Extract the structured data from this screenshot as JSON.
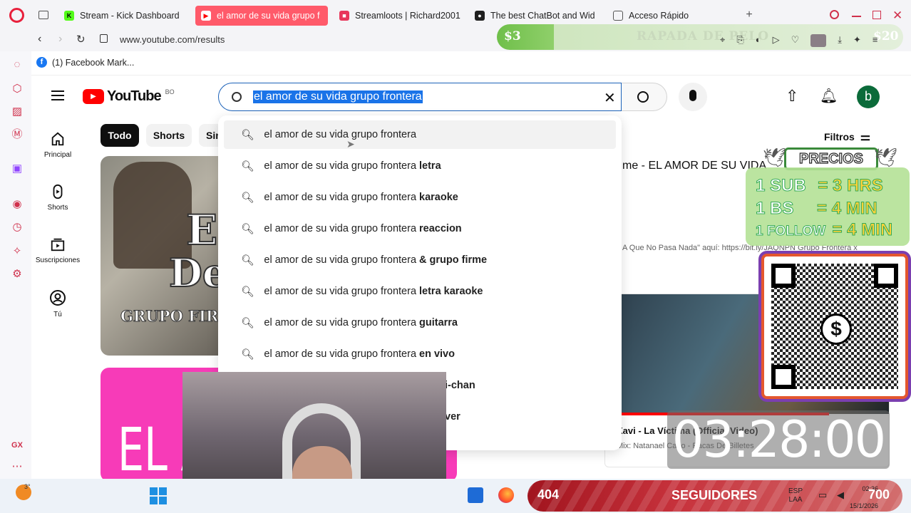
{
  "browser": {
    "tabs": [
      {
        "label": "Stream - Kick Dashboard",
        "color": "#53fc18"
      },
      {
        "label": "el amor de su vida grupo f",
        "color": "#ff0000"
      },
      {
        "label": "Streamloots | Richard2001",
        "color": "#e8365a"
      },
      {
        "label": "The best ChatBot and Wid",
        "color": "#1f1f1f"
      },
      {
        "label": "Acceso Rápido",
        "color": "#555555"
      }
    ],
    "url": "www.youtube.com/results",
    "bookmark": "(1) Facebook Mark..."
  },
  "youtube": {
    "logo": "YouTube",
    "region": "BO",
    "search_value": "el amor de su vida grupo frontera",
    "avatar_letter": "b",
    "filters_label": "Filtros",
    "chips": [
      "Todo",
      "Shorts",
      "Sin"
    ],
    "nav": [
      {
        "label": "Principal",
        "icon": "home-icon"
      },
      {
        "label": "Shorts",
        "icon": "shorts-icon"
      },
      {
        "label": "Suscripciones",
        "icon": "subscriptions-icon"
      },
      {
        "label": "Tú",
        "icon": "you-icon"
      }
    ],
    "suggestion_base": "el amor de su vida grupo frontera",
    "suggestions": [
      {
        "suffix": ""
      },
      {
        "suffix": "letra"
      },
      {
        "suffix": "karaoke"
      },
      {
        "suffix": "reaccion"
      },
      {
        "suffix": "& grupo firme"
      },
      {
        "suffix": "letra karaoke"
      },
      {
        "suffix": "guitarra"
      },
      {
        "suffix": "en vivo"
      },
      {
        "suffix": "i-chan"
      },
      {
        "suffix": "ver"
      }
    ],
    "result_title_fragment": "me - EL AMOR DE SU VIDA",
    "result_desc_fragment": "A Que No Pasa Nada\" aquí: https://bit.ly/JAQNPN Grupo Frontera x",
    "thumb1_text_line1": "E",
    "thumb1_text_line2": "De",
    "thumb1_text_line3": "GRUPO FIRM",
    "thumb2_text": "EL A",
    "mini_player_title": "Xavi - La Víctima (Official Video)",
    "mini_player_sub": "Mix: Natanael Cano - Pacas De Billetes"
  },
  "overlays": {
    "donation_amount": "$3",
    "donation_goal": "$20",
    "donation_label": "RAPADA DE PELO",
    "prices_title": "PRECIOS",
    "prices": [
      {
        "left": "1 SUB",
        "right": "= 3 HRS"
      },
      {
        "left": "1 BS",
        "right": "= 4 MIN"
      },
      {
        "left": "1 FOLLOW",
        "right": "= 4 MIN"
      }
    ],
    "timer": "03:28:00",
    "followers_count": "404",
    "followers_label": "SEGUIDORES",
    "followers_goal": "700"
  },
  "taskbar": {
    "weather": "3°",
    "lang_1": "ESP",
    "lang_2": "LAA",
    "time": "02:36",
    "date": "15/1/2026"
  }
}
